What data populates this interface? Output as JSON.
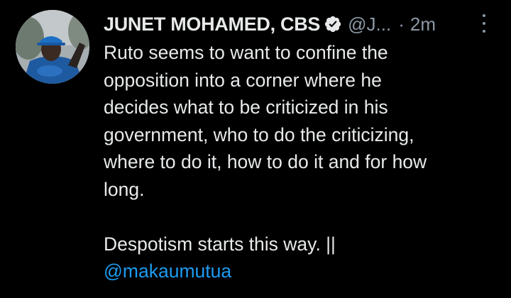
{
  "tweet": {
    "author": {
      "display_name": "JUNET MOHAMED, CBS",
      "handle": "@J...",
      "verified": true,
      "verified_color": "#e7e9ea"
    },
    "separator": "·",
    "timestamp": "2m",
    "body_lines": [
      "Ruto seems to want to confine the",
      "opposition into a corner where he",
      "decides what to be criticized in his",
      "government, who to do the criticizing,",
      "where to do it, how to do it and for how",
      "long."
    ],
    "body_closing": "Despotism starts this way. ||",
    "mention": "@makaumutua",
    "colors": {
      "background": "#000000",
      "text": "#e7e9ea",
      "secondary": "#8b98a5",
      "link": "#1d9bf0"
    },
    "icons": {
      "verified": "verified-badge-icon",
      "more": "more-options-icon"
    }
  }
}
